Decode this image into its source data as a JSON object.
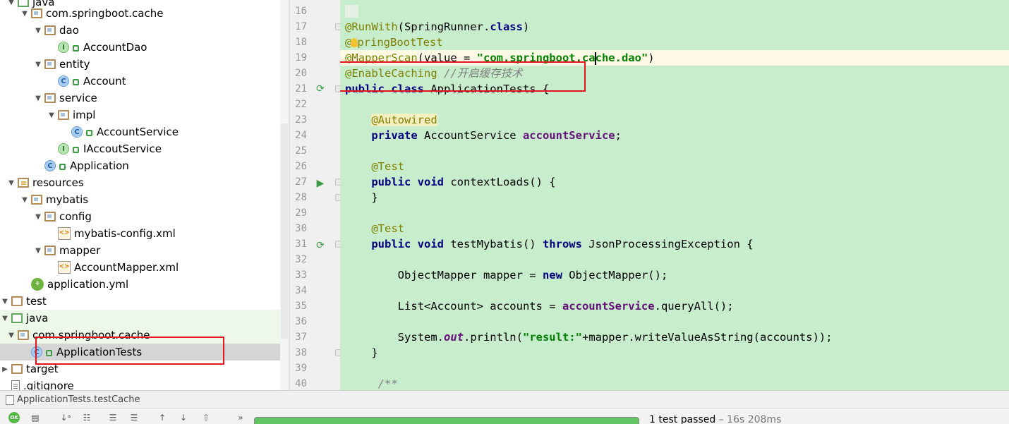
{
  "tree": {
    "rows": [
      {
        "label": "java",
        "kind": "jfolder",
        "arrow": "down"
      },
      {
        "label": "com.springboot.cache",
        "kind": "folder",
        "arrow": "down"
      },
      {
        "label": "dao",
        "kind": "folder",
        "arrow": "down"
      },
      {
        "label": "AccountDao",
        "kind": "interface",
        "arrow": "none"
      },
      {
        "label": "entity",
        "kind": "folder",
        "arrow": "down"
      },
      {
        "label": "Account",
        "kind": "class",
        "arrow": "none"
      },
      {
        "label": "service",
        "kind": "folder",
        "arrow": "down"
      },
      {
        "label": "impl",
        "kind": "folder",
        "arrow": "down"
      },
      {
        "label": "AccountService",
        "kind": "class",
        "arrow": "none"
      },
      {
        "label": "IAccoutService",
        "kind": "interface",
        "arrow": "none"
      },
      {
        "label": "Application",
        "kind": "spring-class",
        "arrow": "none"
      },
      {
        "label": "resources",
        "kind": "res",
        "arrow": "down"
      },
      {
        "label": "mybatis",
        "kind": "folder",
        "arrow": "down"
      },
      {
        "label": "config",
        "kind": "folder",
        "arrow": "down"
      },
      {
        "label": "mybatis-config.xml",
        "kind": "xml",
        "arrow": "none"
      },
      {
        "label": "mapper",
        "kind": "folder",
        "arrow": "down"
      },
      {
        "label": "AccountMapper.xml",
        "kind": "xml",
        "arrow": "none"
      },
      {
        "label": "application.yml",
        "kind": "yml",
        "arrow": "none"
      },
      {
        "label": "test",
        "kind": "tfolder",
        "arrow": "down"
      },
      {
        "label": "java",
        "kind": "jfolder",
        "arrow": "down"
      },
      {
        "label": "com.springboot.cache",
        "kind": "folder",
        "arrow": "down"
      },
      {
        "label": "ApplicationTests",
        "kind": "test-class",
        "arrow": "none"
      },
      {
        "label": "target",
        "kind": "tfolder",
        "arrow": "right"
      },
      {
        "label": ".gitignore",
        "kind": "file",
        "arrow": "none"
      }
    ]
  },
  "editor": {
    "line_numbers": [
      "16",
      "17",
      "18",
      "19",
      "20",
      "21",
      "22",
      "23",
      "24",
      "25",
      "26",
      "27",
      "28",
      "29",
      "30",
      "31",
      "32",
      "33",
      "34",
      "35",
      "36",
      "37",
      "38",
      "39",
      "40"
    ],
    "comment_line20": "//开启缓存技术",
    "string_line19": "\"com.springboot.ca",
    "string_line19_tail": "che.dao\"",
    "string_line37": "\"result:\""
  },
  "run": {
    "title": "ApplicationTests.testCache",
    "status": "1 test passed",
    "duration": " – 16s 208ms",
    "progress": 1.0
  },
  "colors": {
    "editor_bg": "#c7edcc",
    "keyword": "#000080",
    "annotation": "#808000",
    "string": "#008000",
    "field": "#660e7a",
    "annotation_box": "#e2141c"
  }
}
